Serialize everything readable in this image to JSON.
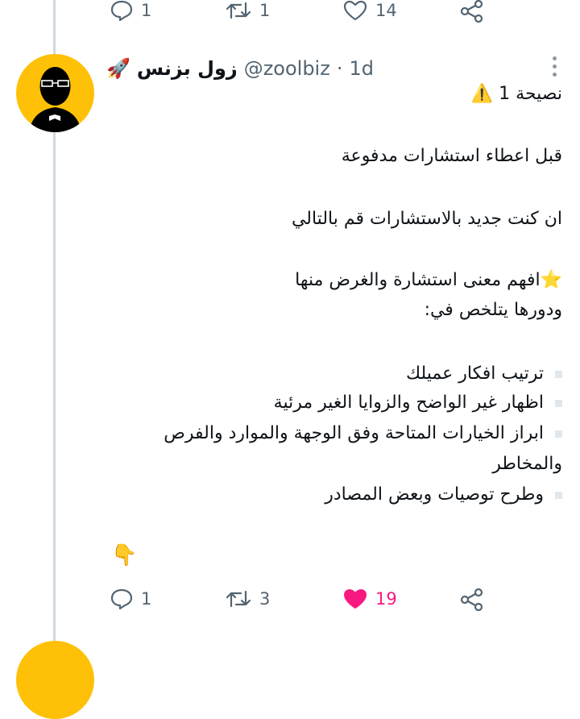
{
  "prev_tweet": {
    "reply_count": "1",
    "retweet_count": "1",
    "like_count": "14"
  },
  "tweet": {
    "display_name": "زول بزنس",
    "name_emoji": "🚀",
    "handle": "@zoolbiz",
    "separator": "·",
    "time": "1d",
    "title_emoji": "⚠️",
    "title": "نصيحة 1",
    "line1": "قبل اعطاء استشارات مدفوعة",
    "line2": "ان كنت جديد بالاستشارات قم بالتالي",
    "star_emoji": "⭐",
    "line3": "افهم معنى استشارة والغرض منها",
    "line4": "ودورها يتلخص في:",
    "bullets": [
      "ترتيب افكار عميلك",
      "اظهار غير الواضح والزوايا الغير مرئية",
      "ابراز الخيارات المتاحة وفق الوجهة والموارد والفرص",
      "والمخاطر",
      "وطرح توصيات وبعض المصادر"
    ],
    "pointing_emoji": "👇",
    "reply_count": "1",
    "retweet_count": "3",
    "like_count": "19",
    "liked_color": "#f91880"
  },
  "icons": [
    "reply-icon",
    "retweet-icon",
    "like-icon",
    "share-icon",
    "more-icon"
  ]
}
